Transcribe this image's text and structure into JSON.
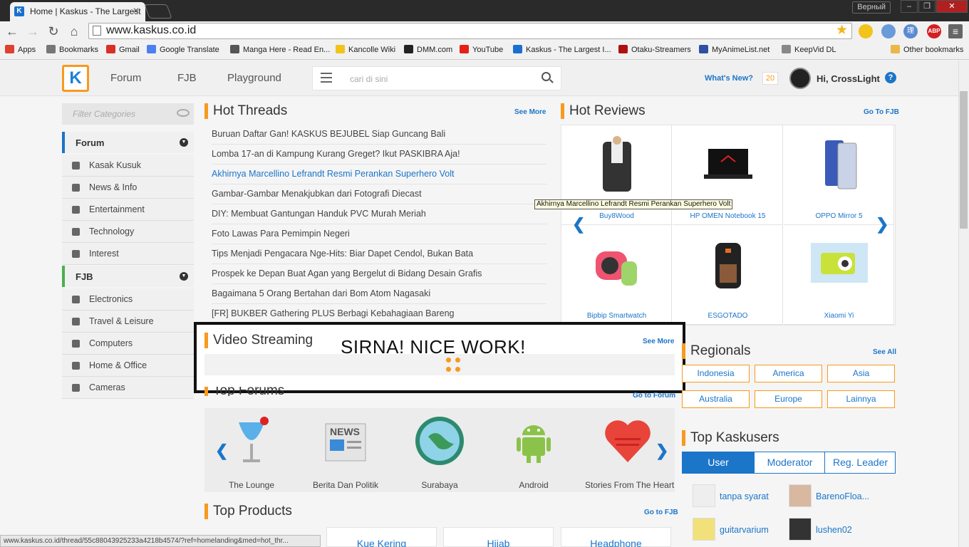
{
  "browser": {
    "tab_title": "Home | Kaskus - The Largest",
    "profile": "Верный",
    "url": "www.kaskus.co.id",
    "status_url": "www.kaskus.co.id/thread/55c88043925233a4218b4574/?ref=homelanding&med=hot_thr..."
  },
  "bookmarks": [
    {
      "label": "Apps",
      "color": "#e04030"
    },
    {
      "label": "Bookmarks",
      "color": "#777777"
    },
    {
      "label": "Gmail",
      "color": "#d93025"
    },
    {
      "label": "Google Translate",
      "color": "#4a80f0"
    },
    {
      "label": "Manga Here - Read En...",
      "color": "#555555"
    },
    {
      "label": "Kancolle Wiki",
      "color": "#f2c31a"
    },
    {
      "label": "DMM.com",
      "color": "#222222"
    },
    {
      "label": "YouTube",
      "color": "#e62117"
    },
    {
      "label": "Kaskus - The Largest I...",
      "color": "#1b6fd0"
    },
    {
      "label": "Otaku-Streamers",
      "color": "#b01010"
    },
    {
      "label": "MyAnimeList.net",
      "color": "#2e51a2"
    },
    {
      "label": "KeepVid DL",
      "color": "#888888"
    }
  ],
  "other_bookmarks": "Other bookmarks",
  "header": {
    "logo": "K",
    "nav": [
      "Forum",
      "FJB",
      "Playground"
    ],
    "search_placeholder": "cari di sini",
    "whats_new": "What's New?",
    "notif_count": "20",
    "greeting": "Hi, CrossLight",
    "help": "?"
  },
  "sidebar": {
    "filter_placeholder": "Filter Categories",
    "forum_title": "Forum",
    "forum_items": [
      "Kasak Kusuk",
      "News & Info",
      "Entertainment",
      "Technology",
      "Interest"
    ],
    "fjb_title": "FJB",
    "fjb_items": [
      "Electronics",
      "Travel & Leisure",
      "Computers",
      "Home & Office",
      "Cameras"
    ]
  },
  "hot_threads": {
    "title": "Hot Threads",
    "see_more": "See More",
    "items": [
      "Buruan Daftar Gan! KASKUS BEJUBEL Siap Guncang Bali",
      "Lomba 17-an di Kampung Kurang Greget? Ikut PASKIBRA Aja!",
      "Akhirnya Marcellino Lefrandt Resmi Perankan Superhero Volt",
      "Gambar-Gambar Menakjubkan dari Fotografi Diecast",
      "DIY: Membuat Gantungan Handuk PVC Murah Meriah",
      "Foto Lawas Para Pemimpin Negeri",
      "Tips Menjadi Pengacara Nge-Hits: Biar Dapet Cendol, Bukan Bata",
      "Prospek ke Depan Buat Agan yang Bergelut di Bidang Desain Grafis",
      "Bagaimana 5 Orang Bertahan dari Bom Atom Nagasaki",
      "[FR] BUKBER Gathering PLUS Berbagi Kebahagiaan Bareng"
    ]
  },
  "tooltip": "Akhirnya Marcellino Lefrandt Resmi Perankan Superhero Volt",
  "hot_reviews": {
    "title": "Hot Reviews",
    "link": "Go To FJB",
    "items": [
      "Buy8Wood",
      "HP OMEN Notebook 15",
      "OPPO Mirror 5",
      "Bipbip Smartwatch",
      "ESGOTADO",
      "Xiaomi Yi"
    ]
  },
  "video_streaming": {
    "title": "Video Streaming",
    "see_more": "See More",
    "overlay": "SIRNA! NICE WORK!"
  },
  "top_forums": {
    "title": "Top Forums",
    "link": "Go to Forum",
    "items": [
      "The Lounge",
      "Berita Dan Politik",
      "Surabaya",
      "Android",
      "Stories From The Heart"
    ],
    "news_text": "NEWS"
  },
  "regionals": {
    "title": "Regionals",
    "see_all": "See All",
    "items": [
      "Indonesia",
      "America",
      "Asia",
      "Australia",
      "Europe",
      "Lainnya"
    ]
  },
  "top_kaskusers": {
    "title": "Top Kaskusers",
    "tabs": [
      "User",
      "Moderator",
      "Reg. Leader"
    ],
    "users": [
      "tanpa syarat",
      "BarenoFloa...",
      "guitarvarium",
      "lushen02"
    ]
  },
  "top_products": {
    "title": "Top Products",
    "link": "Go to FJB",
    "tabs": [
      "Kue Kering",
      "Hijab",
      "Headphone"
    ]
  }
}
